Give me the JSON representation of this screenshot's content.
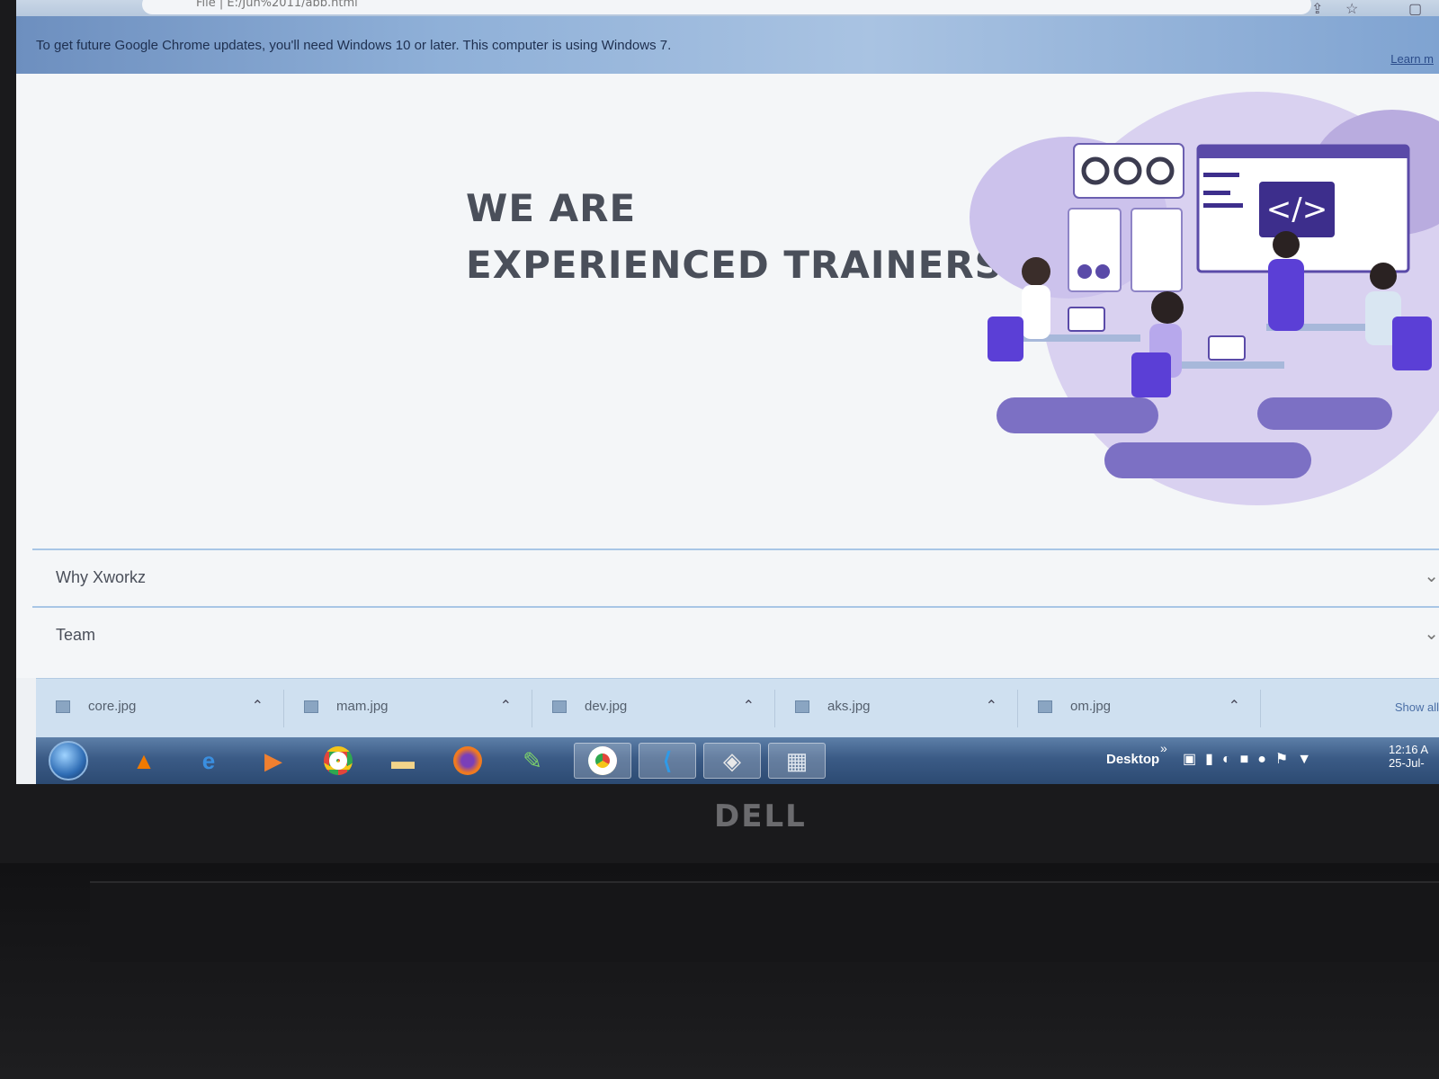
{
  "browser": {
    "address_text": "File | E:/Jun%2011/abb.html",
    "share_icon": "share-icon",
    "bookmark_icon": "star-icon",
    "window_icon": "window-icon"
  },
  "infobar": {
    "message": "To get future Google Chrome updates, you'll need Windows 10 or later. This computer is using Windows 7.",
    "learn_more": "Learn m"
  },
  "hero": {
    "line1": "WE ARE",
    "line2": "EXPERIENCED TRAINERS"
  },
  "accordion": [
    {
      "label": "Why Xworkz"
    },
    {
      "label": "Team"
    }
  ],
  "downloads": {
    "items": [
      {
        "name": "core.jpg"
      },
      {
        "name": "mam.jpg"
      },
      {
        "name": "dev.jpg"
      },
      {
        "name": "aks.jpg"
      },
      {
        "name": "om.jpg"
      }
    ],
    "show_all": "Show all"
  },
  "taskbar": {
    "apps": [
      "vlc-icon",
      "internet-explorer-icon",
      "media-player-icon",
      "chrome-icon",
      "folder-icon",
      "firefox-icon",
      "notepad-icon",
      "chrome-active-icon",
      "vscode-icon",
      "git-icon",
      "file-manager-icon"
    ],
    "desktop_label": "Desktop",
    "chevron": "»",
    "time": "12:16 A",
    "date": "25-Jul-"
  },
  "device": {
    "logo": "DELL"
  }
}
